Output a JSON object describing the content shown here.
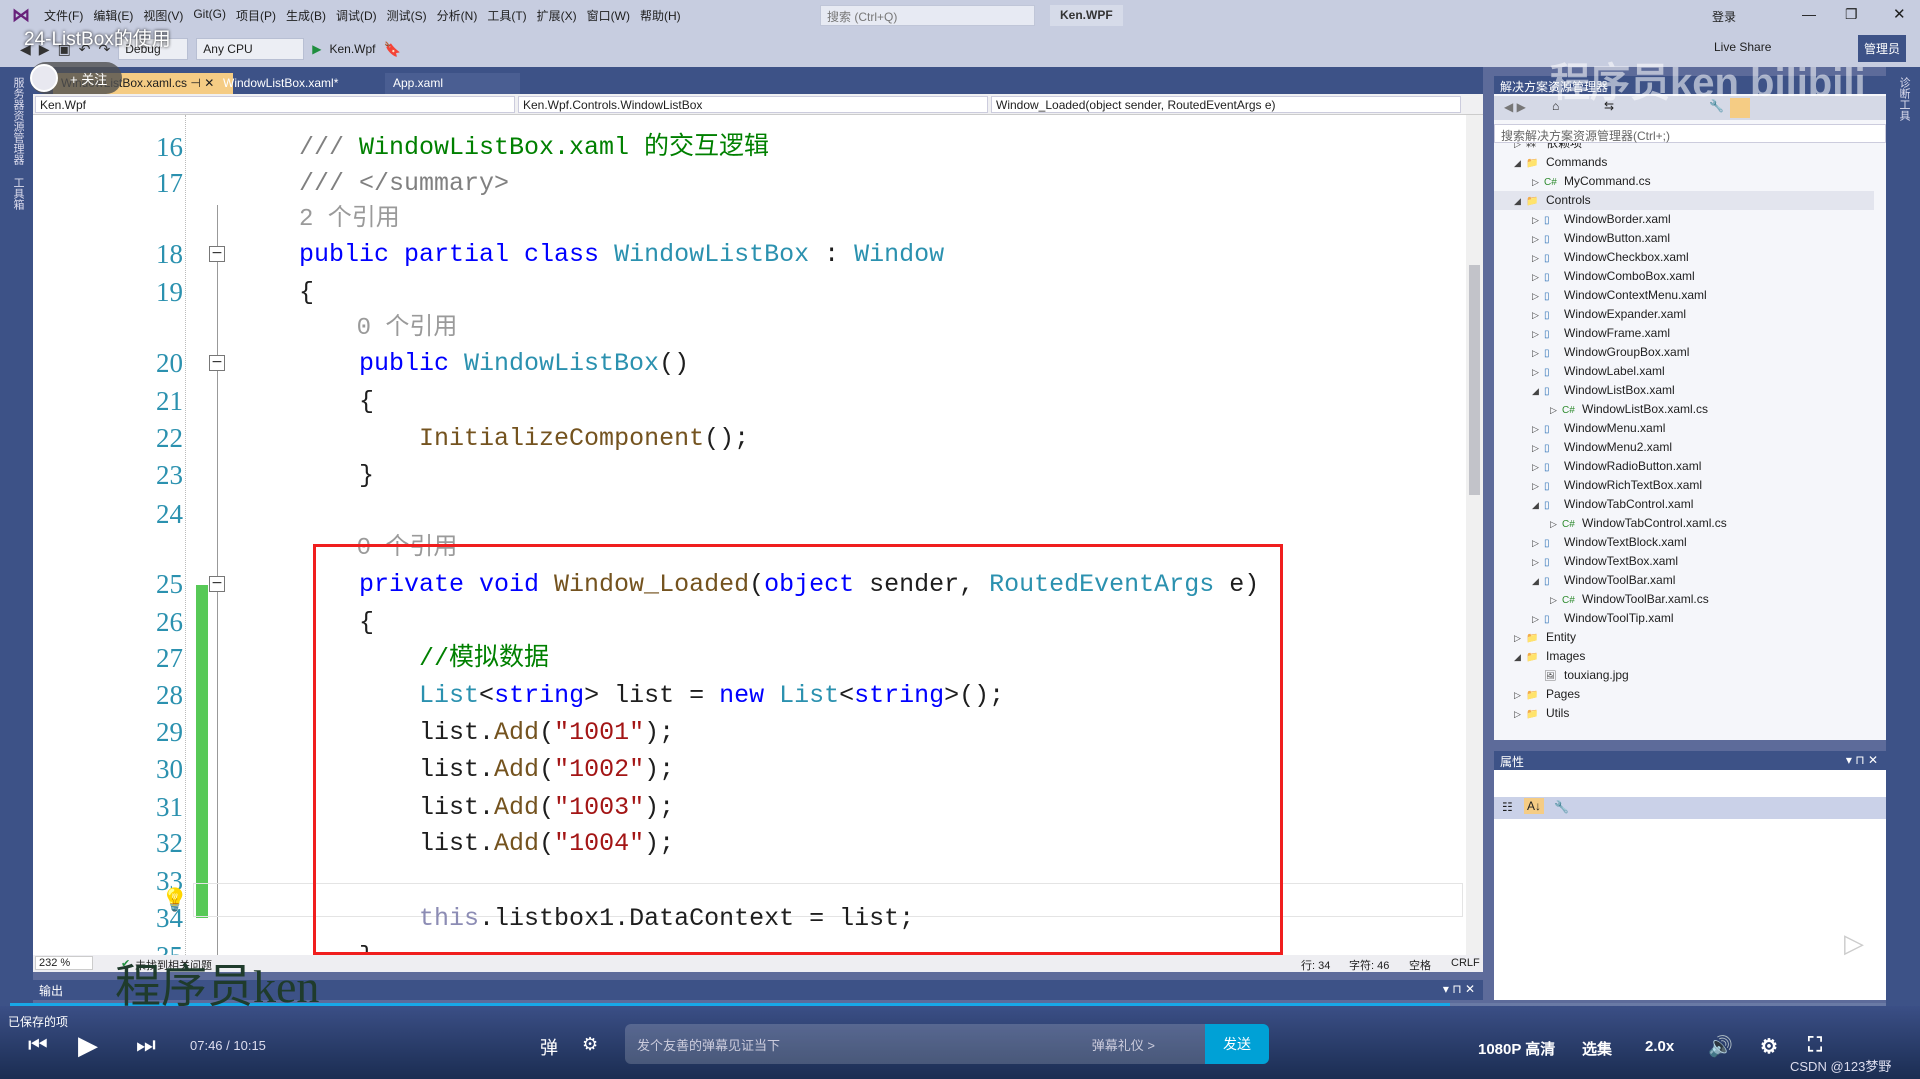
{
  "menubar": {
    "items": [
      "文件(F)",
      "编辑(E)",
      "视图(V)",
      "Git(G)",
      "项目(P)",
      "生成(B)",
      "调试(D)",
      "测试(S)",
      "分析(N)",
      "工具(T)",
      "扩展(X)",
      "窗口(W)",
      "帮助(H)"
    ],
    "search_placeholder": "搜索 (Ctrl+Q)",
    "project": "Ken.WPF",
    "login": "登录",
    "admin": "管理员",
    "live_share": "Live Share"
  },
  "toolbar": {
    "config": "Debug",
    "platform": "Any CPU",
    "start": "Ken.Wpf"
  },
  "video_title": "24-ListBox的使用",
  "follow": "+ 关注",
  "tabs": [
    {
      "label": "WindowListBox.xaml.cs",
      "active": true
    },
    {
      "label": "WindowListBox.xaml*"
    },
    {
      "label": "App.xaml"
    }
  ],
  "nav": {
    "project": "Ken.Wpf",
    "class": "Ken.Wpf.Controls.WindowListBox",
    "member": "Window_Loaded(object sender, RoutedEventArgs e)"
  },
  "left_strip": [
    "服务器资源管理器",
    "工具箱"
  ],
  "code": [
    {
      "n": "16",
      "t": [
        [
          "/// ",
          "g"
        ],
        [
          "WindowListBox.xaml 的交互逻辑",
          "c"
        ]
      ]
    },
    {
      "n": "17",
      "t": [
        [
          "/// </summary>",
          "g"
        ]
      ]
    },
    {
      "n": "",
      "t": [
        [
          "2 个引用",
          "lens"
        ]
      ]
    },
    {
      "n": "18",
      "fold": true,
      "t": [
        [
          "public partial class ",
          "k"
        ],
        [
          "WindowListBox",
          "t"
        ],
        [
          " : ",
          "p"
        ],
        [
          "Window",
          "t"
        ]
      ]
    },
    {
      "n": "19",
      "t": [
        [
          "{",
          "p"
        ]
      ]
    },
    {
      "n": "",
      "t": [
        [
          "    0 个引用",
          "lens"
        ]
      ]
    },
    {
      "n": "20",
      "fold": true,
      "t": [
        [
          "    public ",
          "k"
        ],
        [
          "WindowListBox",
          "t"
        ],
        [
          "()",
          "p"
        ]
      ]
    },
    {
      "n": "21",
      "t": [
        [
          "    {",
          "p"
        ]
      ]
    },
    {
      "n": "22",
      "t": [
        [
          "        ",
          "p"
        ],
        [
          "InitializeComponent",
          "m"
        ],
        [
          "();",
          "p"
        ]
      ]
    },
    {
      "n": "23",
      "t": [
        [
          "    }",
          "p"
        ]
      ]
    },
    {
      "n": "24",
      "t": [
        [
          "",
          "p"
        ]
      ]
    },
    {
      "n": "",
      "t": [
        [
          "    0 个引用",
          "lens"
        ]
      ]
    },
    {
      "n": "25",
      "fold": true,
      "t": [
        [
          "    private void ",
          "k"
        ],
        [
          "Window_Loaded",
          "m"
        ],
        [
          "(",
          "p"
        ],
        [
          "object",
          "k"
        ],
        [
          " sender, ",
          "p"
        ],
        [
          "RoutedEventArgs",
          "t"
        ],
        [
          " e)",
          "p"
        ]
      ]
    },
    {
      "n": "26",
      "t": [
        [
          "    {",
          "p"
        ]
      ]
    },
    {
      "n": "27",
      "t": [
        [
          "        //模拟数据",
          "c"
        ]
      ]
    },
    {
      "n": "28",
      "t": [
        [
          "        ",
          "p"
        ],
        [
          "List",
          "t"
        ],
        [
          "<",
          "p"
        ],
        [
          "string",
          "k"
        ],
        [
          "> list = ",
          "p"
        ],
        [
          "new ",
          "k"
        ],
        [
          "List",
          "t"
        ],
        [
          "<",
          "p"
        ],
        [
          "string",
          "k"
        ],
        [
          ">();",
          "p"
        ]
      ]
    },
    {
      "n": "29",
      "t": [
        [
          "        list.",
          "p"
        ],
        [
          "Add",
          "m"
        ],
        [
          "(",
          "p"
        ],
        [
          "\"1001\"",
          "s"
        ],
        [
          ");",
          "p"
        ]
      ]
    },
    {
      "n": "30",
      "t": [
        [
          "        list.",
          "p"
        ],
        [
          "Add",
          "m"
        ],
        [
          "(",
          "p"
        ],
        [
          "\"1002\"",
          "s"
        ],
        [
          ");",
          "p"
        ]
      ]
    },
    {
      "n": "31",
      "t": [
        [
          "        list.",
          "p"
        ],
        [
          "Add",
          "m"
        ],
        [
          "(",
          "p"
        ],
        [
          "\"1003\"",
          "s"
        ],
        [
          ");",
          "p"
        ]
      ]
    },
    {
      "n": "32",
      "t": [
        [
          "        list.",
          "p"
        ],
        [
          "Add",
          "m"
        ],
        [
          "(",
          "p"
        ],
        [
          "\"1004\"",
          "s"
        ],
        [
          ");",
          "p"
        ]
      ]
    },
    {
      "n": "33",
      "t": [
        [
          "",
          "p"
        ]
      ]
    },
    {
      "n": "34",
      "t": [
        [
          "        ",
          "p"
        ],
        [
          "this",
          "th"
        ],
        [
          ".listbox1.DataContext = list;",
          "p"
        ]
      ]
    },
    {
      "n": "35",
      "t": [
        [
          "    }",
          "p"
        ]
      ]
    }
  ],
  "editor_status": {
    "zoom": "232 %",
    "issues": "未找到相关问题",
    "line": "行: 34",
    "char": "字符: 46",
    "spaces": "空格",
    "eol": "CRLF"
  },
  "output": {
    "title": "输出"
  },
  "solution_explorer": {
    "title": "解决方案资源管理器",
    "search_placeholder": "搜索解决方案资源管理器(Ctrl+;)",
    "items": [
      {
        "label": "依赖项",
        "level": 1,
        "state": "collapsed",
        "icon": "dependencies"
      },
      {
        "label": "Commands",
        "level": 1,
        "state": "expanded",
        "icon": "folder"
      },
      {
        "label": "MyCommand.cs",
        "level": 2,
        "state": "collapsed",
        "icon": "csharp"
      },
      {
        "label": "Controls",
        "level": 1,
        "state": "expanded",
        "icon": "folder",
        "selected": true
      },
      {
        "label": "WindowBorder.xaml",
        "level": 2,
        "state": "collapsed",
        "icon": "xaml"
      },
      {
        "label": "WindowButton.xaml",
        "level": 2,
        "state": "collapsed",
        "icon": "xaml"
      },
      {
        "label": "WindowCheckbox.xaml",
        "level": 2,
        "state": "collapsed",
        "icon": "xaml"
      },
      {
        "label": "WindowComboBox.xaml",
        "level": 2,
        "state": "collapsed",
        "icon": "xaml"
      },
      {
        "label": "WindowContextMenu.xaml",
        "level": 2,
        "state": "collapsed",
        "icon": "xaml"
      },
      {
        "label": "WindowExpander.xaml",
        "level": 2,
        "state": "collapsed",
        "icon": "xaml"
      },
      {
        "label": "WindowFrame.xaml",
        "level": 2,
        "state": "collapsed",
        "icon": "xaml"
      },
      {
        "label": "WindowGroupBox.xaml",
        "level": 2,
        "state": "collapsed",
        "icon": "xaml"
      },
      {
        "label": "WindowLabel.xaml",
        "level": 2,
        "state": "collapsed",
        "icon": "xaml"
      },
      {
        "label": "WindowListBox.xaml",
        "level": 2,
        "state": "expanded",
        "icon": "xaml"
      },
      {
        "label": "WindowListBox.xaml.cs",
        "level": 3,
        "state": "collapsed",
        "icon": "csharp"
      },
      {
        "label": "WindowMenu.xaml",
        "level": 2,
        "state": "collapsed",
        "icon": "xaml"
      },
      {
        "label": "WindowMenu2.xaml",
        "level": 2,
        "state": "collapsed",
        "icon": "xaml"
      },
      {
        "label": "WindowRadioButton.xaml",
        "level": 2,
        "state": "collapsed",
        "icon": "xaml"
      },
      {
        "label": "WindowRichTextBox.xaml",
        "level": 2,
        "state": "collapsed",
        "icon": "xaml"
      },
      {
        "label": "WindowTabControl.xaml",
        "level": 2,
        "state": "expanded",
        "icon": "xaml"
      },
      {
        "label": "WindowTabControl.xaml.cs",
        "level": 3,
        "state": "collapsed",
        "icon": "csharp"
      },
      {
        "label": "WindowTextBlock.xaml",
        "level": 2,
        "state": "collapsed",
        "icon": "xaml"
      },
      {
        "label": "WindowTextBox.xaml",
        "level": 2,
        "state": "collapsed",
        "icon": "xaml"
      },
      {
        "label": "WindowToolBar.xaml",
        "level": 2,
        "state": "expanded",
        "icon": "xaml"
      },
      {
        "label": "WindowToolBar.xaml.cs",
        "level": 3,
        "state": "collapsed",
        "icon": "csharp"
      },
      {
        "label": "WindowToolTip.xaml",
        "level": 2,
        "state": "collapsed",
        "icon": "xaml"
      },
      {
        "label": "Entity",
        "level": 1,
        "state": "collapsed",
        "icon": "folder"
      },
      {
        "label": "Images",
        "level": 1,
        "state": "expanded",
        "icon": "folder"
      },
      {
        "label": "touxiang.jpg",
        "level": 2,
        "state": "none",
        "icon": "image"
      },
      {
        "label": "Pages",
        "level": 1,
        "state": "collapsed",
        "icon": "folder"
      },
      {
        "label": "Utils",
        "level": 1,
        "state": "collapsed",
        "icon": "folder"
      }
    ]
  },
  "properties": {
    "title": "属性"
  },
  "right_strip": "诊断工具",
  "player": {
    "saved": "已保存的项",
    "time": "07:46 / 10:15",
    "danmu_placeholder": "发个友善的弹幕见证当下",
    "etiquette": "弹幕礼仪 >",
    "send": "发送",
    "quality": "1080P 高清",
    "episodes": "选集",
    "speed": "2.0x"
  },
  "watermarks": {
    "channel": "程序员ken",
    "site": "bilibili",
    "csdn": "CSDN @123梦野"
  },
  "colors": {
    "accent": "#3d5287",
    "highlight_box": "#f01e1e",
    "change_bar": "#57c957",
    "send": "#00a1d6"
  }
}
